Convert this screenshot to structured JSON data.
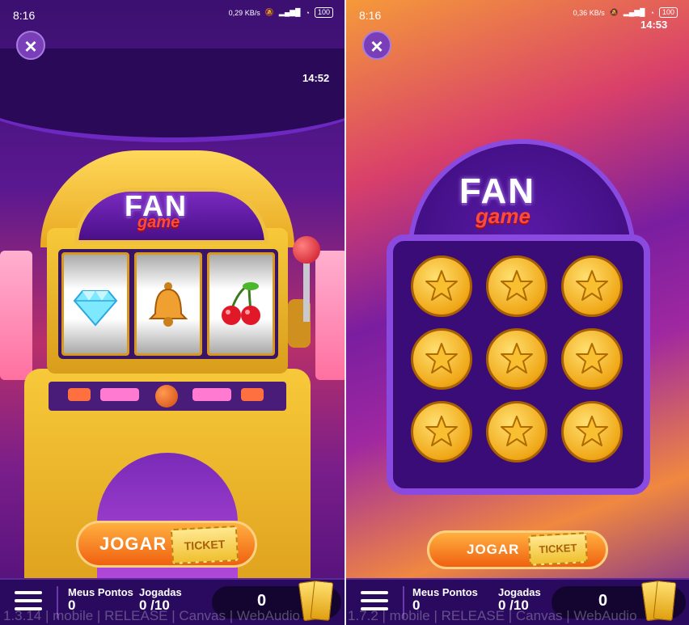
{
  "screens": [
    {
      "status_time": "8:16",
      "net_speed": "0,29 KB/s",
      "battery": "100",
      "game_clock": "14:52",
      "logo_top": "FAN",
      "logo_bottom": "game",
      "reels": [
        "diamond-icon",
        "bell-icon",
        "cherry-icon"
      ],
      "play_label": "JOGAR",
      "ticket_label": "TICKET",
      "points_label": "Meus Pontos",
      "points_value": "0",
      "plays_label": "Jogadas",
      "plays_value": "0 /10",
      "balance": "0",
      "build_text": "1.3.14 | mobile | RELEASE | Canvas | WebAudio"
    },
    {
      "status_time": "8:16",
      "net_speed": "0,36 KB/s",
      "battery": "100",
      "game_clock": "14:53",
      "logo_top": "FAN",
      "logo_bottom": "game",
      "coins": 9,
      "play_label": "JOGAR",
      "ticket_label": "TICKET",
      "points_label": "Meus Pontos",
      "points_value": "0",
      "plays_label": "Jogadas",
      "plays_value": "0 /10",
      "balance": "0",
      "build_text": "1.7.2 | mobile | RELEASE | Canvas | WebAudio"
    }
  ]
}
